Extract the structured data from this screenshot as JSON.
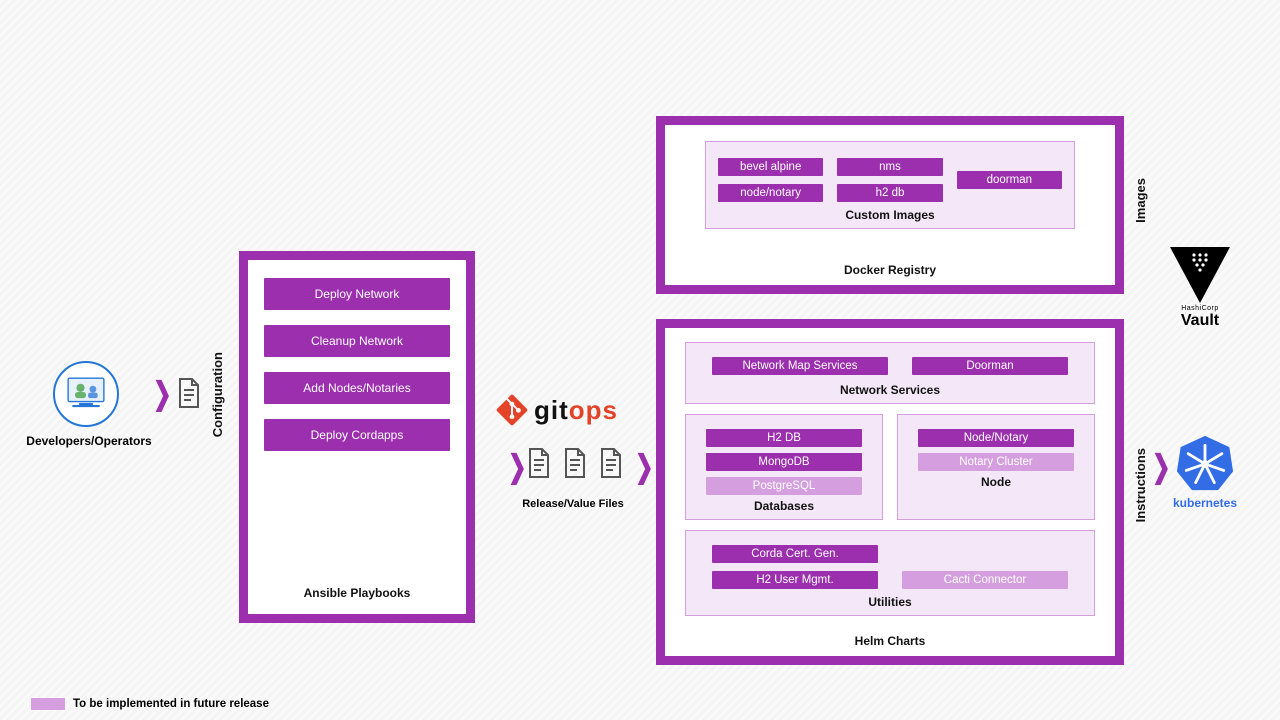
{
  "dev_caption": "Developers/Operators",
  "side_labels": {
    "configuration": "Configuration",
    "images": "Images",
    "instructions": "Instructions"
  },
  "ansible": {
    "title": "Ansible Playbooks",
    "items": [
      "Deploy Network",
      "Cleanup Network",
      "Add Nodes/Notaries",
      "Deploy Cordapps"
    ]
  },
  "gitops": {
    "git": "git",
    "ops": "ops"
  },
  "files_caption": "Release/Value Files",
  "docker": {
    "title": "Docker Registry",
    "inner_title": "Custom Images",
    "images": [
      "bevel alpine",
      "nms",
      "doorman",
      "node/notary",
      "h2 db"
    ]
  },
  "helm": {
    "title": "Helm Charts",
    "network_services": {
      "title": "Network Services",
      "items": [
        "Network Map Services",
        "Doorman"
      ]
    },
    "databases": {
      "title": "Databases",
      "items": [
        {
          "label": "H2 DB",
          "future": false
        },
        {
          "label": "MongoDB",
          "future": false
        },
        {
          "label": "PostgreSQL",
          "future": true
        }
      ]
    },
    "node": {
      "title": "Node",
      "items": [
        {
          "label": "Node/Notary",
          "future": false
        },
        {
          "label": "Notary Cluster",
          "future": true
        }
      ]
    },
    "utilities": {
      "title": "Utilities",
      "items": [
        {
          "label": "Corda Cert. Gen.",
          "future": false
        },
        {
          "label": "",
          "future": null
        },
        {
          "label": "H2 User Mgmt.",
          "future": false
        },
        {
          "label": "Cacti Connector",
          "future": true
        }
      ]
    }
  },
  "external": {
    "vault_brand": "HashiCorp",
    "vault_name": "Vault",
    "k8s": "kubernetes"
  },
  "footnote": "To be implemented in future release"
}
